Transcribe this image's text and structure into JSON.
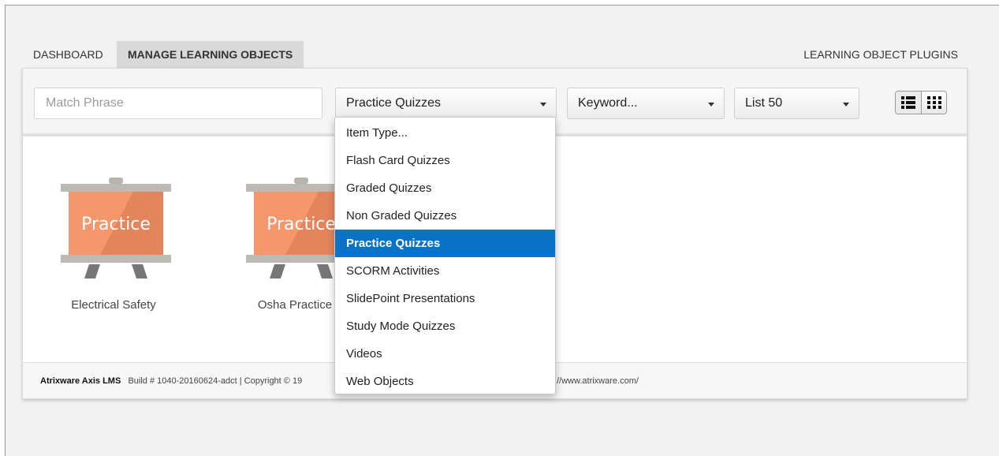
{
  "tabs": {
    "dashboard": "DASHBOARD",
    "manage": "MANAGE LEARNING OBJECTS",
    "plugins": "LEARNING OBJECT PLUGINS"
  },
  "filters": {
    "search_placeholder": "Match Phrase",
    "search_value": "",
    "type_selected": "Practice Quizzes",
    "keyword_selected": "Keyword...",
    "list_selected": "List 50"
  },
  "view_toggle": {
    "list_icon": "list-view-icon",
    "grid_icon": "grid-view-icon"
  },
  "items": [
    {
      "icon_label": "Practice",
      "title": "Electrical Safety"
    },
    {
      "icon_label": "Practice",
      "title": "Osha Practice"
    }
  ],
  "footer": {
    "brand": "Atrixware Axis LMS",
    "build": "Build # 1040-20160624-adct | Copyright © 19",
    "url": "//www.atrixware.com/"
  },
  "type_options": [
    "Item Type...",
    "Flash Card Quizzes",
    "Graded Quizzes",
    "Non Graded Quizzes",
    "Practice Quizzes",
    "SCORM Activities",
    "SlidePoint Presentations",
    "Study Mode Quizzes",
    "Videos",
    "Web Objects"
  ],
  "colors": {
    "selected_option": "#0a73c8",
    "easel_board": "#f4976c",
    "easel_frame": "#bcbab2"
  }
}
